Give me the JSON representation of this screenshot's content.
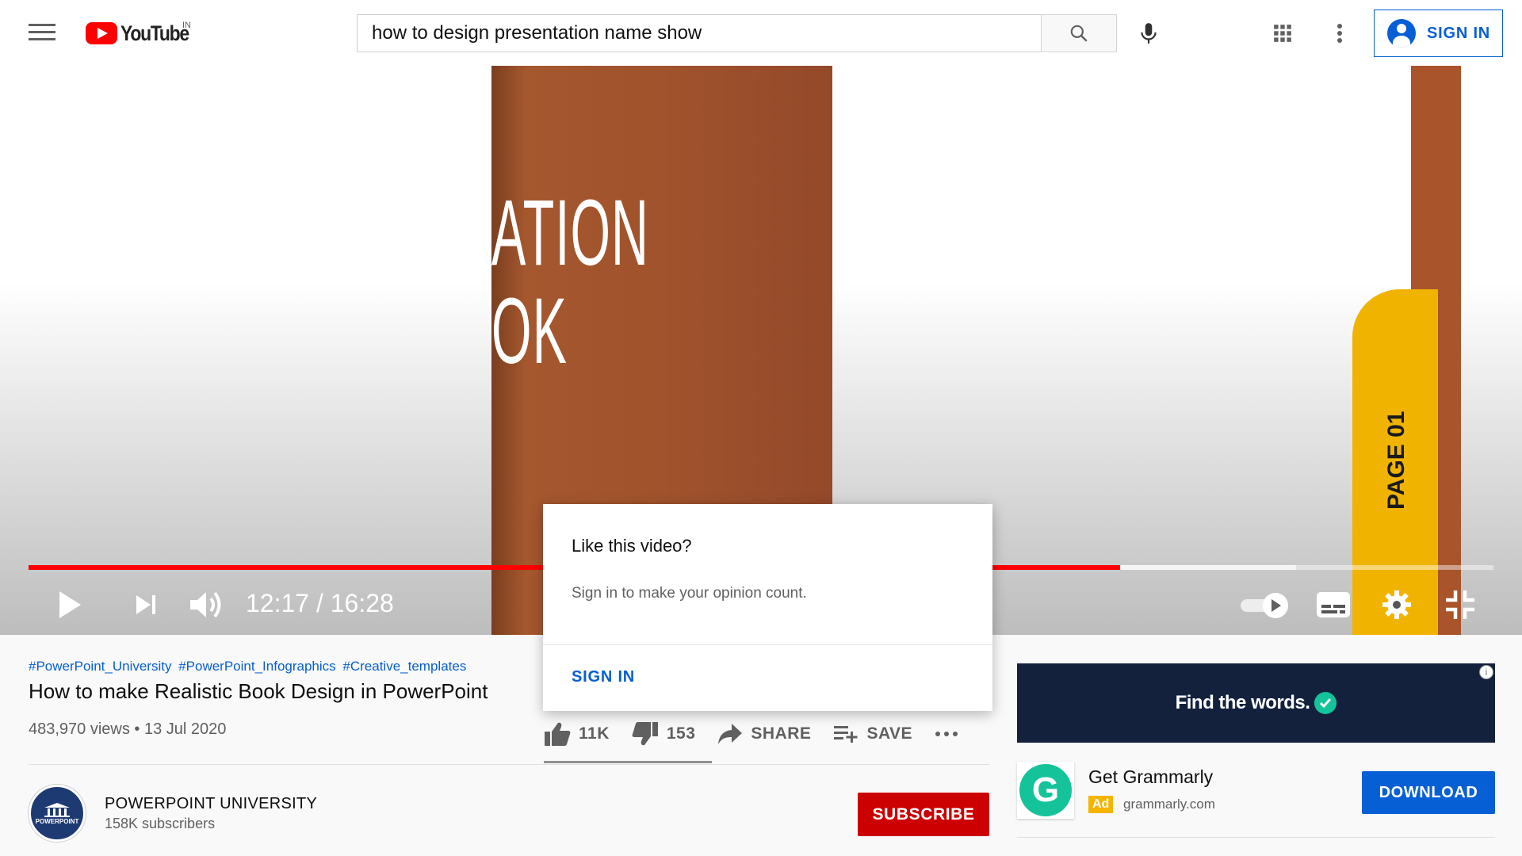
{
  "header": {
    "logo_text": "YouTube",
    "country_code": "IN",
    "search_value": "how to design presentation name show",
    "signin_label": "SIGN IN"
  },
  "player": {
    "overlay_text_line1": "ATION",
    "overlay_text_line2": "OK",
    "tab_text": "PAGE 01",
    "current_time": "12:17",
    "duration": "16:28",
    "time_display": "12:17 / 16:28",
    "played_fraction": 0.745,
    "buffered_fraction": 0.865
  },
  "video": {
    "hashtags": [
      "#PowerPoint_University",
      "#PowerPoint_Infographics",
      "#Creative_templates"
    ],
    "title": "How to make Realistic Book Design in PowerPoint",
    "meta": "483,970 views • 13 Jul 2020",
    "like_count": "11K",
    "dislike_count": "153",
    "share_label": "SHARE",
    "save_label": "SAVE"
  },
  "channel": {
    "name": "POWERPOINT UNIVERSITY",
    "subscribers": "158K subscribers",
    "avatar_text": "POWERPOINT",
    "subscribe_label": "SUBSCRIBE"
  },
  "popup": {
    "title": "Like this video?",
    "body": "Sign in to make your opinion count.",
    "signin_label": "SIGN IN"
  },
  "ad": {
    "banner_text": "Find the words.",
    "title": "Get Grammarly",
    "badge": "Ad",
    "domain": "grammarly.com",
    "download_label": "DOWNLOAD",
    "info_glyph": "i"
  },
  "colors": {
    "youtube_red": "#ff0000",
    "link_blue": "#065fd4",
    "subscribe_red": "#cc0000",
    "grammarly_green": "#15c39a",
    "ad_navy": "#14213d"
  },
  "icons": [
    "menu-icon",
    "search-icon",
    "mic-icon",
    "apps-icon",
    "more-vert-icon",
    "account-icon",
    "play-icon",
    "next-icon",
    "volume-icon",
    "autoplay-toggle-icon",
    "captions-icon",
    "settings-icon",
    "exit-fullscreen-icon",
    "thumb-up-icon",
    "thumb-down-icon",
    "share-icon",
    "playlist-add-icon",
    "more-horiz-icon",
    "check-icon",
    "info-icon"
  ]
}
